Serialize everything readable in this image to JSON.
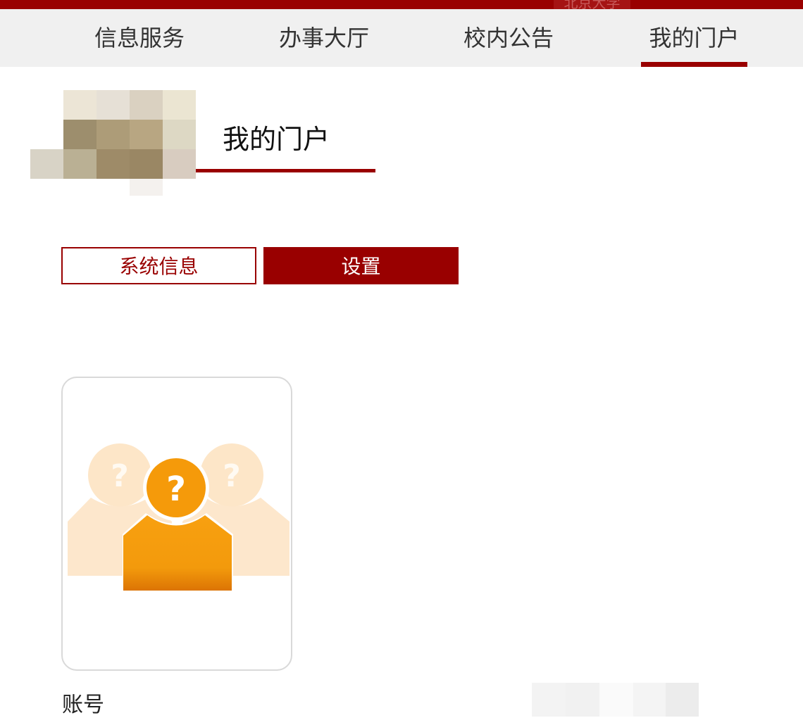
{
  "top_bar": {
    "label": "北京大学"
  },
  "nav": {
    "items": [
      {
        "label": "信息服务"
      },
      {
        "label": "办事大厅"
      },
      {
        "label": "校内公告"
      },
      {
        "label": "我的门户"
      }
    ],
    "active": "我的门户"
  },
  "page": {
    "title": "我的门户"
  },
  "tabs": {
    "system_info": "系统信息",
    "settings": "设置",
    "active": "设置"
  },
  "avatar": {
    "icon": "unknown-users-icon",
    "glyph": "?"
  },
  "account": {
    "label": "账号"
  },
  "colors": {
    "brand": "#990000",
    "nav_bg": "#f0f0f0",
    "avatar_orange": "#f29a0b",
    "avatar_light": "#fde9cf"
  }
}
